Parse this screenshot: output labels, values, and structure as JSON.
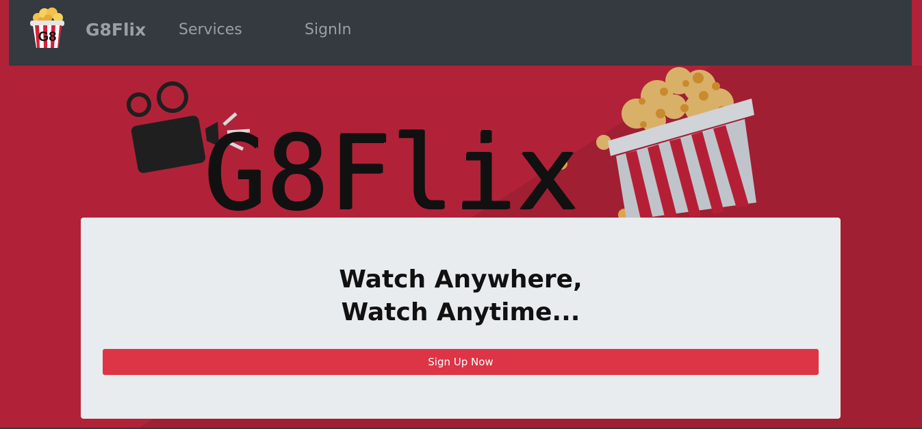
{
  "navbar": {
    "logo_text": "G8",
    "brand": "G8Flix",
    "links": [
      {
        "label": "Services"
      },
      {
        "label": "SignIn"
      }
    ]
  },
  "hero": {
    "title": "G8Flix"
  },
  "card": {
    "headline_line1": "Watch Anywhere,",
    "headline_line2": "Watch Anytime...",
    "signup_label": "Sign Up Now"
  },
  "colors": {
    "page_background": "#b12238",
    "navbar_background": "#343a40",
    "nav_text": "#9a9fa4",
    "card_background": "#e9ecef",
    "button_background": "#dc3545",
    "popcorn_yellow": "#d9a64e"
  },
  "icons": {
    "logo": "popcorn-bucket-logo",
    "camera": "movie-camera-icon",
    "popcorn": "popcorn-bucket-icon"
  }
}
